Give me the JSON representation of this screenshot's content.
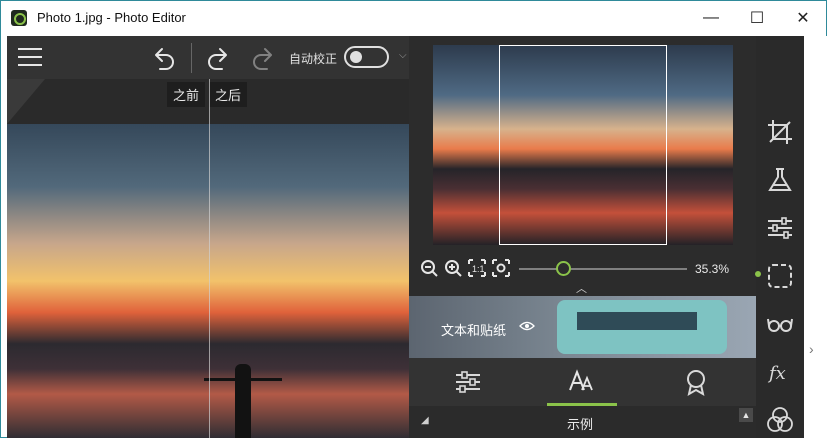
{
  "window": {
    "title": "Photo 1.jpg - Photo Editor",
    "minimize": "—",
    "maximize": "☐",
    "close": "✕"
  },
  "toolbar": {
    "menu_icon": "hamburger-menu-icon",
    "undo_icon": "undo-icon",
    "redo_icon": "redo-icon",
    "auto_correct_label": "自动校正"
  },
  "compare": {
    "before_label": "之前",
    "after_label": "之后"
  },
  "preview": {
    "zoom_value": "35.3%"
  },
  "banner": {
    "label": "文本和贴纸"
  },
  "section": {
    "title": "示例"
  },
  "sidebar": {
    "items": [
      {
        "icon": "crop-icon"
      },
      {
        "icon": "flask-icon"
      },
      {
        "icon": "sliders-icon"
      },
      {
        "icon": "selection-icon"
      },
      {
        "icon": "glasses-icon"
      },
      {
        "icon": "fx-icon"
      },
      {
        "icon": "color-circles-icon"
      }
    ]
  },
  "colors": {
    "accent": "#8bc34a",
    "panel": "#2c2c2c",
    "toolbar": "#333333"
  }
}
